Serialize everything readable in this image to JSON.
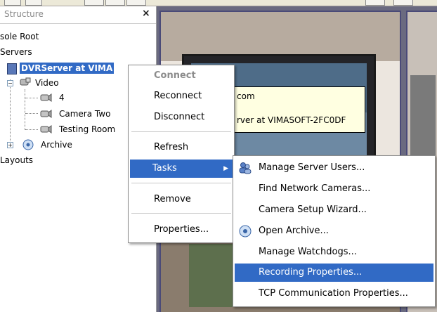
{
  "panel": {
    "title": "Structure",
    "close": "×"
  },
  "tree": {
    "console_root": "sole Root",
    "servers": "Servers",
    "server": "DVRServer at VIMA",
    "video": "Video",
    "camera_4": "4",
    "camera_two": "Camera Two",
    "testing_room": "Testing Room",
    "archive": "Archive",
    "layouts": "Layouts"
  },
  "tooltip": {
    "line1": "com",
    "line2": "rver at VIMASOFT-2FC0DF"
  },
  "context_menu": {
    "connect": "Connect",
    "reconnect": "Reconnect",
    "disconnect": "Disconnect",
    "refresh": "Refresh",
    "tasks": "Tasks",
    "remove": "Remove",
    "properties": "Properties..."
  },
  "tasks_menu": {
    "manage_users": "Manage Server Users...",
    "find_cameras": "Find Network Cameras...",
    "setup_wizard": "Camera Setup Wizard...",
    "open_archive": "Open Archive...",
    "watchdogs": "Manage Watchdogs...",
    "recording_props": "Recording Properties...",
    "tcp_props": "TCP Communication Properties..."
  },
  "colors": {
    "highlight": "#316ac5",
    "tooltip_bg": "#ffffe1"
  }
}
